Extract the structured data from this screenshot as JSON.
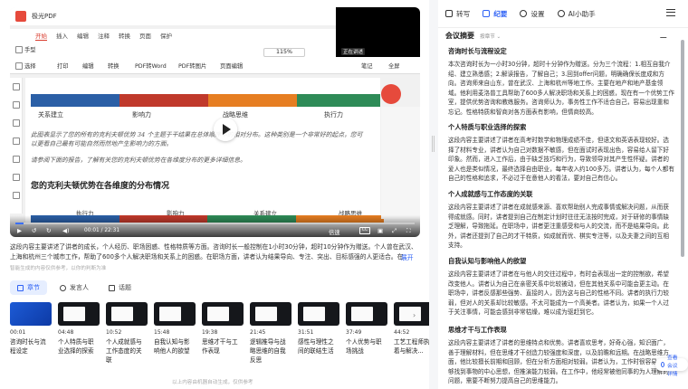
{
  "video": {
    "pdf_app_title": "极光PDF",
    "pdf_tabs": [
      "开始",
      "插入",
      "编辑",
      "注释",
      "转换",
      "页面",
      "保护"
    ],
    "pdf_active_tab": "开始",
    "toolbar": {
      "hand": "手型",
      "select": "选择",
      "print": "打印",
      "edit": "编辑",
      "convert": "转换",
      "pdf_to_word": "PDF转Word",
      "pdf_to_image": "PDF转图片",
      "page_edit": "页面编辑",
      "zoom": "115%",
      "note": "笔记",
      "fullscreen": "全屏"
    },
    "cam_label": "正在讲述",
    "slide": {
      "labels_top": [
        "关系建立",
        "影响力",
        "战略思维",
        "执行力"
      ],
      "para1": "此图表显示了您的所有的克利夫顿优势 34 个主题于干结果在总体顺序中的相对分布。这种类别是一个非常好的起点，您可以更看自己最有可能自然而然地产生影响力的方面。",
      "para2": "请参阅下面的报告，了解有关您的克利夫顿优势在各维度分布的更多详细信息。",
      "heading": "您的克利夫顿优势在各维度的分布情况",
      "table_head": [
        "执行力",
        "影响力",
        "关系建立",
        "战略思维"
      ],
      "colors": [
        "#2b5fa6",
        "#c0392b",
        "#e67e22",
        "#2e8b57"
      ]
    },
    "controls": {
      "time": "00:01 / 22:31",
      "speed": "倍速",
      "cc": "CC",
      "progress": 0.02
    }
  },
  "summary": {
    "text": "这段内容主要讲述了讲者的成长，个人经历、职场困惑、性格特质等方面。咨询时长一般控制在1小时30分钟，超时10分钟作为赠送。个人曾在武汉、上海和杭州三个城市工作，帮助了600多个人解决职场和关系上的困惑。在职场方面，讲者认为结果导向、专注、突出、目标感强的人更适合。在",
    "expand": "展开",
    "ai_note": "智能生成的内容仅供参考，以你的判断为准"
  },
  "segment_tabs": [
    {
      "label": "章节",
      "active": true
    },
    {
      "label": "发言人",
      "active": false
    },
    {
      "label": "话题",
      "active": false
    }
  ],
  "chapters": [
    {
      "time": "00:01",
      "title": "咨询时长与流程设定"
    },
    {
      "time": "04:48",
      "title": "个人特质与职业选择的探索"
    },
    {
      "time": "10:52",
      "title": "个人成就感与工作态度的关联"
    },
    {
      "time": "15:48",
      "title": "自我认知与影响他人的欲望"
    },
    {
      "time": "19:38",
      "title": "思维才干与工作表现"
    },
    {
      "time": "21:45",
      "title": "逻辑推导与战略思维的自我反思"
    },
    {
      "time": "31:51",
      "title": "感性与理性之间的联结生活"
    },
    {
      "time": "37:49",
      "title": "个人优势与职场挑战"
    },
    {
      "time": "44:52",
      "title": "工艺工程师执着与解决..."
    }
  ],
  "footer_note": "以上内容由机器自动生成，仅供参考",
  "right_tabs": [
    {
      "label": "转写",
      "active": false
    },
    {
      "label": "纪要",
      "active": true
    },
    {
      "label": "设置",
      "active": false
    },
    {
      "label": "AI小助手",
      "active": false
    }
  ],
  "summary_panel": {
    "title": "会议摘要",
    "subtitle": "按章节 ⌄",
    "sections": [
      {
        "title": "咨询时长与流程设定",
        "body": "本次咨询时长为一小时30分钟，超时十分钟作为赠送。分为三个流程：1.相互自我介绍、建立熟悉感；2.解读报告，了解自己；3.回到offer问题，明确确保长度成和方向。咨询师来自山东，曾在武汉、上海和杭州等地工作。主要在地产和地产基金领域。他利用麦洛普工具帮助了600多人解决职场和关系上的困惑，现在有一个优势工作室，提供优势咨询和教练服务。咨询师认为，事务性工作不适合自己，容易出现重和忘记。性格特质和智商对各方面表有影响，但情商较高。"
      },
      {
        "title": "个人特质与职业选择的探索",
        "body": "这段内容主要讲述了讲者在高考时数学和物理成绩不佳，但语文和英语表现较好。选择了材料专业，讲者认为自己对数据不敏感，但在面试时表现出色，容易给人留下好印象。然而，进入工作后，由于缺乏技巧和行为，导致领导对其产生性怀疑。讲者的爱人也是类似情况，最终选择自由职业，每年收入约100多万。讲者认为，每个人都有自己的性格和追求，不必过于在意他人的看法，要对自己有信心。"
      },
      {
        "title": "个人成就感与工作态度的关联",
        "body": "这段内容主要讲述了讲者在成就感来源、喜欢帮助别人完成事情或解决问题，从而获得成就感。同时，讲者提到自己在制定计划时往往无法按时完成，对于研修的事情缺乏理解，导致拖延。在职场中，讲者更注重感受和与人的交流，而不是结果导向。此外，讲者还提到了自己的才干特质，如成就而优、棋实专注等，以及夫妻之间的互相支持。"
      },
      {
        "title": "自我认知与影响他人的欲望",
        "body": "这段内容主要讲述了讲者在与他人的交往过程中，有时会表现出一定的控制欲，希望改变他人。讲者认为自己在亲密关系中比较被动，但在其他关系中可能会更主动。在职场中，讲者反感那些强势、直接的人，因为这与自己的性格不同。讲者的执行力较弱，但对人的关系却比较敏感。不太可能成为一个高美者。讲者认为，如果一个人过于关注事情，可能会感到非常枯燥，难以成为驱赶到它。"
      },
      {
        "title": "思维才干与工作表现",
        "body": "这段内容主要讲述了讲者的思维特点和优势。讲者喜欢思考，好奇心强，知识面广，善于理解材料，但在思维才干创造力较强度和深度，以及前瞻和远期。在战略思维方面，他比较擅长前期和回顾，但在分析方面相对较弱。讲者认为，工作时很容易，能够找到事物的中心思想，但推演能力较弱。在工作中，他经常被他同事的为人理解的问题，需要不断努力提高自己的思维能力。"
      }
    ],
    "fab": "查看会议详情"
  }
}
